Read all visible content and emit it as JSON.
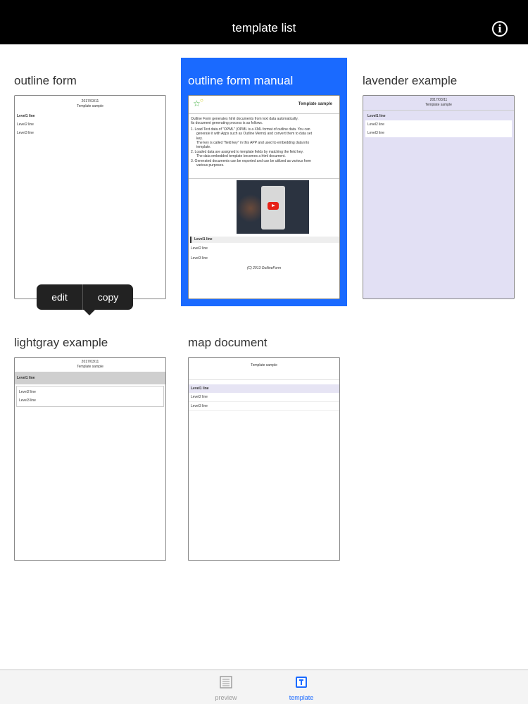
{
  "navbar": {
    "title": "template list",
    "info_icon": "info-icon"
  },
  "templates": [
    {
      "name": "outline form",
      "date": "2017/03/11",
      "sample": "Template sample",
      "level1": "Level1 line",
      "level2": "Level2 line",
      "level3": "Level3 line"
    },
    {
      "name": "outline form manual",
      "header_title": "Template sample",
      "body": [
        "Outline Form generates html documents from text data automatically.",
        "Its document generating process is as follows.",
        "1.  Load Text data of \"OPML\" (OPML is a XML format of outline data. You can",
        "generate it with Apps such as Outline Memo) and convert them to data set",
        "key.",
        "The key is called \"field key\" in this APP and used to embedding data into",
        "template.",
        "2.  Loaded data are assigned to template fields by matching the field key.",
        "The data embedded template becomes a html document.",
        "3.  Generated documents can be exported and can be utilized as various form",
        "various purposes."
      ],
      "level1": "Level1 line",
      "level2": "Level2 line",
      "level3": "Level3 line",
      "copyright": "(C) 2013 OutlineForm"
    },
    {
      "name": "lavender example",
      "date": "2017/03/11",
      "sample": "Template sample",
      "level1": "Level1 line",
      "level2": "Level2 line",
      "level3": "Level3 line"
    },
    {
      "name": "lightgray example",
      "date": "2017/03/11",
      "sample": "Template sample",
      "level1": "Level1 line",
      "level2": "Level2 line",
      "level3": "Level3 line"
    },
    {
      "name": "map document",
      "sample": "Template sample",
      "level1": "Level1 line",
      "level2": "Level2 line",
      "level3": "Level3 line"
    }
  ],
  "context_menu": {
    "edit": "edit",
    "copy": "copy"
  },
  "tabbar": {
    "preview": "preview",
    "template": "template"
  },
  "colors": {
    "accent": "#1a6aff",
    "lavender": "#e2e0f4",
    "lightgray": "#cfcfcf"
  }
}
